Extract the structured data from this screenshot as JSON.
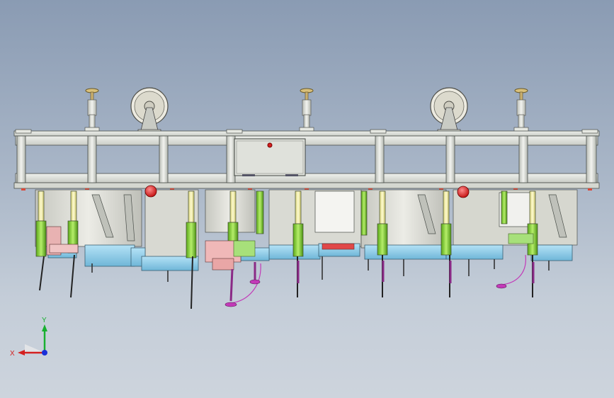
{
  "triad": {
    "x_label": "X",
    "y_label": "Y",
    "colors": {
      "x": "#d42020",
      "y": "#18b030",
      "z": "#1a2fd8"
    }
  },
  "colors": {
    "frame": "#dde1dc",
    "frame_edge": "#4a4f4a",
    "panel_light_blue": "#86c8e6",
    "cylinder_green": "#8fdc3a",
    "cylinder_yellow": "#f4f0a0",
    "body_gray": "#d6d7cf",
    "clamp_purple": "#c23ab8",
    "stop_red": "#e02020",
    "handwheel": "#e8e6da"
  },
  "icons": [
    "handwheel-icon",
    "cylinder-icon",
    "clamp-arm-icon",
    "leveling-foot-icon",
    "axis-triad-icon"
  ]
}
